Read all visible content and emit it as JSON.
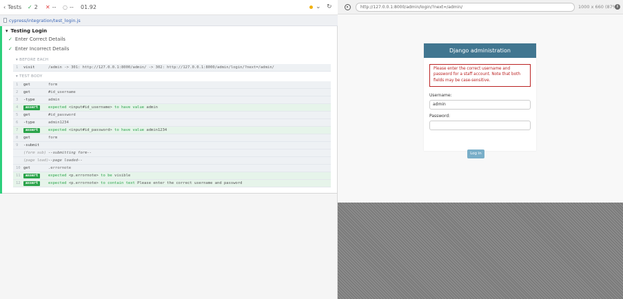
{
  "stats": {
    "tests_label": "Tests",
    "passed": "2",
    "failed": "--",
    "pending": "--",
    "duration": "01.92"
  },
  "spec": {
    "path": "cypress/integration/test_login.js"
  },
  "suite": {
    "title": "Testing Login"
  },
  "tests": [
    "Enter Correct Details",
    "Enter Incorrect Details"
  ],
  "before_each": {
    "title": "BEFORE EACH",
    "commands": [
      {
        "num": "1",
        "name": "visit",
        "msg": "/admin -> 301: http://127.0.0.1:8000/admin/ -> 302: http://127.0.0.1:8000/admin/login/?next=/admin/"
      }
    ]
  },
  "test_body": {
    "title": "TEST BODY",
    "commands": [
      {
        "num": "1",
        "name": "get",
        "msg": "form"
      },
      {
        "num": "2",
        "name": "get",
        "msg": "#id_username"
      },
      {
        "num": "3",
        "name": "-type",
        "msg": "admin"
      },
      {
        "num": "4",
        "name": "assert",
        "msg_a": "expected",
        "msg_b": "<input#id_username>",
        "msg_c": "to have value",
        "msg_d": "admin"
      },
      {
        "num": "5",
        "name": "get",
        "msg": "#id_password"
      },
      {
        "num": "6",
        "name": "-type",
        "msg": "admin1234"
      },
      {
        "num": "7",
        "name": "assert",
        "msg_a": "expected",
        "msg_b": "<input#id_password>",
        "msg_c": "to have value",
        "msg_d": "admin1234"
      },
      {
        "num": "8",
        "name": "get",
        "msg": "form"
      },
      {
        "num": "9",
        "name": "-submit",
        "msg": ""
      },
      {
        "num": "",
        "name": "(form sub)",
        "msg": "--submitting form--"
      },
      {
        "num": "",
        "name": "(page load)",
        "msg": "--page loaded--"
      },
      {
        "num": "10",
        "name": "get",
        "msg": ".errornote"
      },
      {
        "num": "11",
        "name": "assert",
        "msg_a": "expected",
        "msg_b": "<p.errornote>",
        "msg_c": "to be",
        "msg_d": "visible"
      },
      {
        "num": "12",
        "name": "assert",
        "msg_a": "expected",
        "msg_b": "<p.errornote>",
        "msg_c": "to contain text",
        "msg_d": "Please enter the correct username and password"
      }
    ]
  },
  "aut": {
    "url": "http://127.0.0.1:8000/admin/login/?next=/admin/",
    "viewport": "1000 x 660  (87%)",
    "info": "i"
  },
  "login": {
    "header": "Django administration",
    "error": "Please enter the correct username and password for a staff account. Note that both fields may be case-sensitive.",
    "username_label": "Username:",
    "username_value": "admin",
    "password_label": "Password:",
    "password_value": "",
    "button": "Log in"
  },
  "colors": {
    "accent": "#417690",
    "error": "#ba2121",
    "pass": "#2aa34a",
    "fail": "#e23b3b",
    "button": "#79aec8"
  }
}
